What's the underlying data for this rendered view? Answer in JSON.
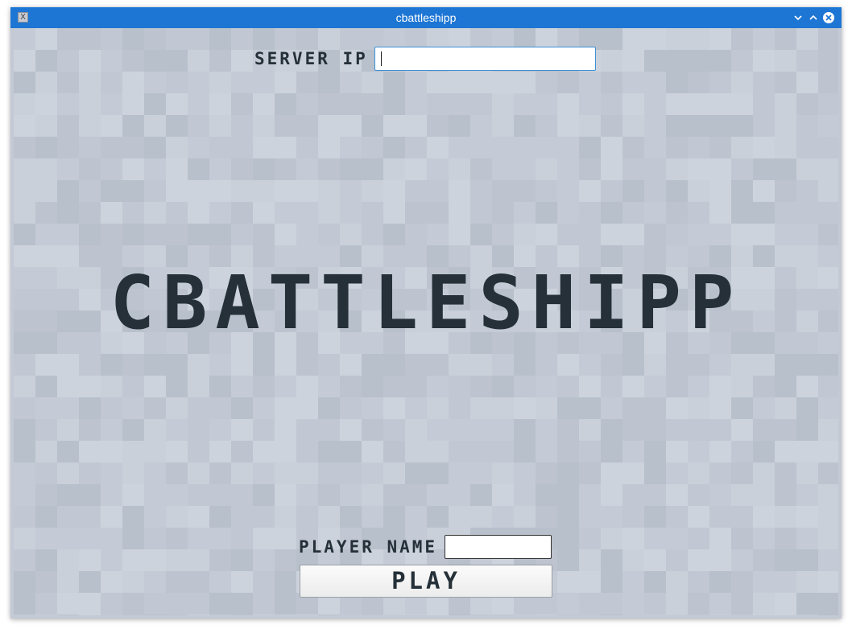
{
  "window": {
    "title": "cbattleshipp",
    "app_icon": "x-window-icon",
    "controls": [
      "minimize-icon",
      "maximize-icon",
      "close-icon"
    ],
    "accent_color": "#1e76d4"
  },
  "server": {
    "label": "SERVER IP",
    "value": ""
  },
  "game": {
    "title": "CBATTLESHIPP"
  },
  "player": {
    "label": "PLAYER NAME",
    "value": ""
  },
  "play_button": {
    "label": "PLAY"
  },
  "colors": {
    "background": "#c4cbd6",
    "text": "#253038"
  }
}
